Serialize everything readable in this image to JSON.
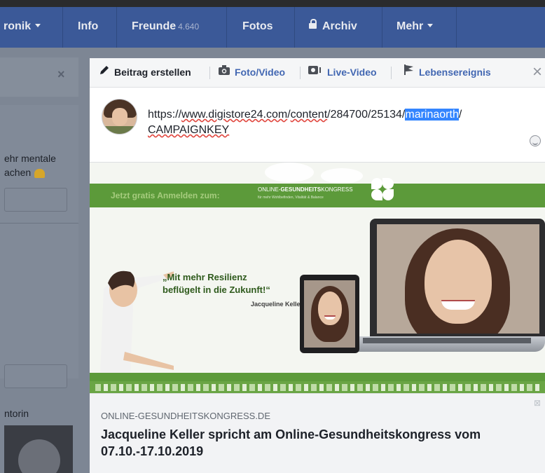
{
  "nav": {
    "items": [
      {
        "label": "ronik",
        "has_caret": true
      },
      {
        "label": "Info"
      },
      {
        "label": "Freunde",
        "count": "4.640"
      },
      {
        "label": "Fotos"
      },
      {
        "label": "Archiv",
        "icon": "lock-icon"
      },
      {
        "label": "Mehr",
        "has_caret": true
      }
    ]
  },
  "background": {
    "close_label": "×",
    "post_text_line1": "ehr mentale",
    "post_text_line2": "achen",
    "sidebar_label": "ntorin"
  },
  "composer": {
    "tabs": [
      {
        "label": "Beitrag erstellen",
        "icon": "pencil-icon"
      },
      {
        "label": "Foto/Video",
        "icon": "camera-icon"
      },
      {
        "label": "Live-Video",
        "icon": "live-video-icon"
      },
      {
        "label": "Lebensereignis",
        "icon": "flag-icon"
      }
    ],
    "close_label": "×",
    "url": {
      "part1": "https://",
      "part2": "www.digistore24.com",
      "part3": "/",
      "part4": "content",
      "part5": "/284700/25134/",
      "highlighted": "marinaorth",
      "part6": "/",
      "line2": "CAMPAIGNKEY"
    }
  },
  "preview": {
    "banner": {
      "cta": "Jetzt gratis Anmelden zum:",
      "kongress_title_a": "ONLINE-",
      "kongress_title_b": "GESUNDHEITS",
      "kongress_title_c": "KONGRESS",
      "kongress_sub": "für mehr Wohlbefinden, Vitalität & Balance",
      "quote_line1": "„Mit mehr Resilienz",
      "quote_line2": "beflügelt in die Zukunft!“",
      "quote_author": "Jacqueline Keller"
    },
    "domain": "ONLINE-GESUNDHEITSKONGRESS.DE",
    "headline": "Jacqueline Keller spricht am Online-Gesundheitskongress vom 07.10.-17.10.2019",
    "remove_label": "⊠"
  },
  "colors": {
    "facebook_blue": "#3b5998",
    "link_blue": "#4267b2",
    "banner_green": "#5c9a3a",
    "highlight": "#3385ff"
  }
}
